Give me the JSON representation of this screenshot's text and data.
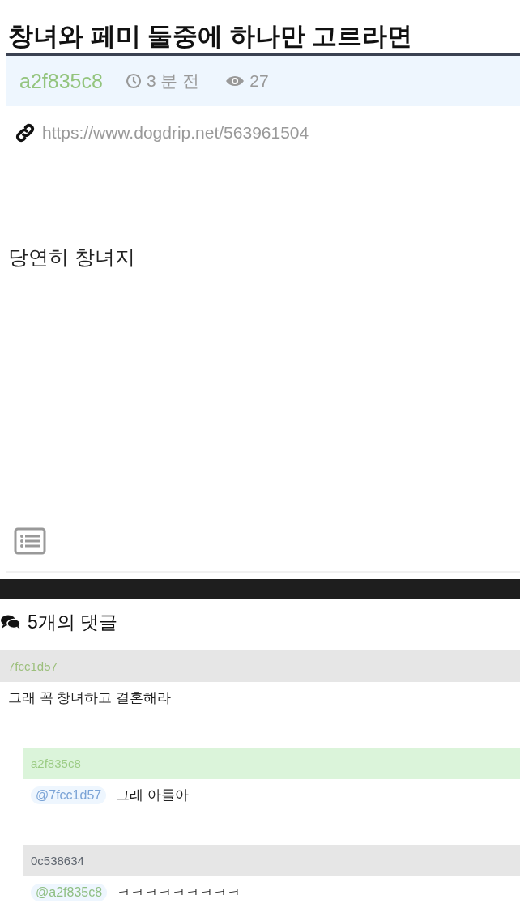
{
  "post": {
    "title": "창녀와 페미 둘중에 하나만 고르라면",
    "author": "a2f835c8",
    "time": "3 분 전",
    "views": "27",
    "link": "https://www.dogdrip.net/563961504",
    "body": "당연히 창녀지"
  },
  "comments_header": {
    "label": "5개의 댓글"
  },
  "comments": [
    {
      "author": "7fcc1d57",
      "color": "#9cbf7c",
      "is_op": false,
      "reply": false,
      "text": "그래 꼭 창녀하고 결혼해라"
    },
    {
      "author": "a2f835c8",
      "color": "#9ccc85",
      "is_op": true,
      "reply": true,
      "mention": {
        "text": "@7fcc1d57",
        "color": "#7aa3d6"
      },
      "text": "그래 아들아"
    },
    {
      "author": "0c538634",
      "color": "#5f6670",
      "is_op": false,
      "reply": true,
      "mention": {
        "text": "@a2f835c8",
        "color": "#8fbf83"
      },
      "text": "ㅋㅋㅋㅋㅋㅋㅋㅋㅋ"
    }
  ]
}
